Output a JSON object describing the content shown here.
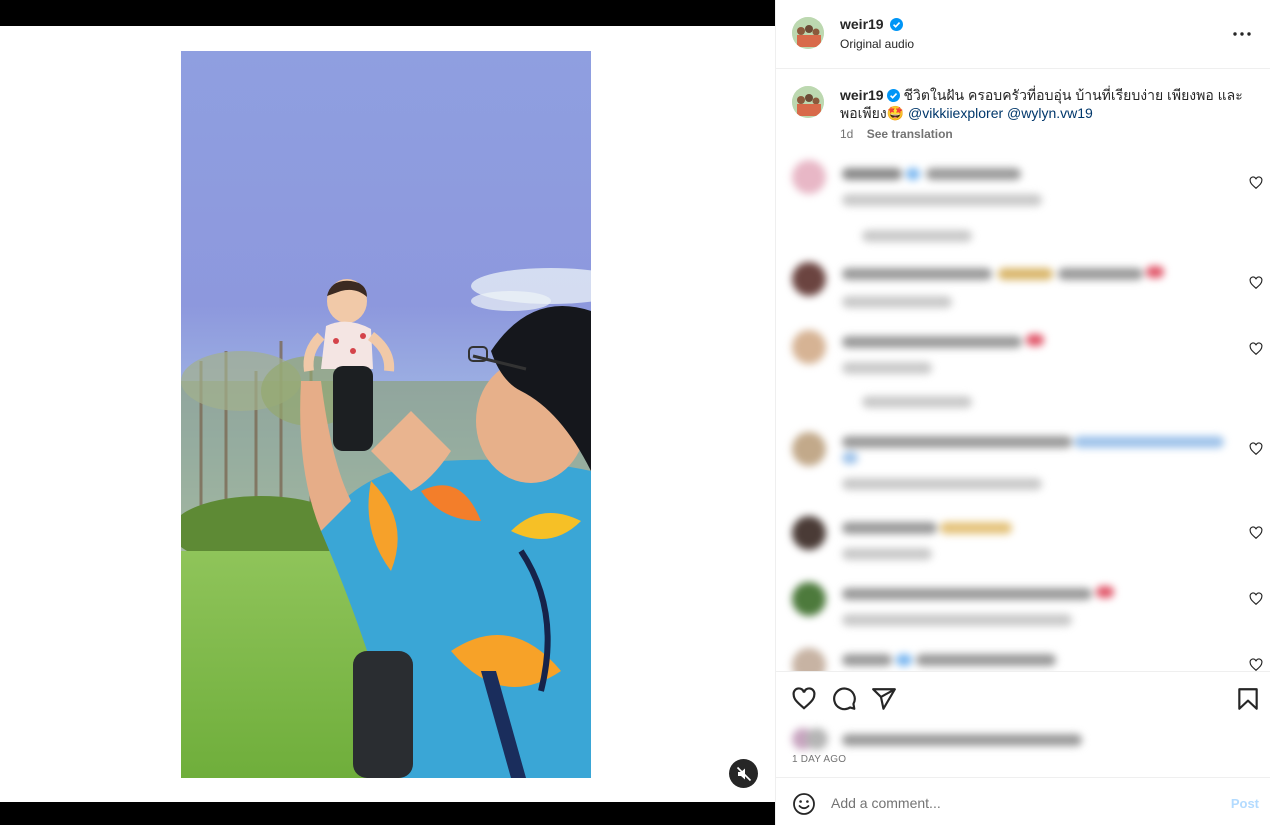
{
  "post": {
    "username": "weir19",
    "audio_label": "Original audio",
    "caption": {
      "username": "weir19",
      "text": "ชีวิตในฝัน ครอบครัวที่อบอุ่น บ้านที่เรียบง่าย เพียงพอ และพอเพียง🤩",
      "mentions": [
        "@vikkiiexplorer",
        "@wylyn.vw19"
      ],
      "time": "1d",
      "see_translation": "See translation"
    }
  },
  "actions": {
    "icons": [
      "heart-icon",
      "comment-icon",
      "share-icon",
      "bookmark-icon"
    ],
    "time_ago": "1 DAY AGO"
  },
  "comment_box": {
    "placeholder": "Add a comment...",
    "post_label": "Post"
  },
  "colors": {
    "verified": "#0095f6",
    "link": "#00376b",
    "post_disabled": "#b3dbff",
    "divider": "#efefef"
  }
}
